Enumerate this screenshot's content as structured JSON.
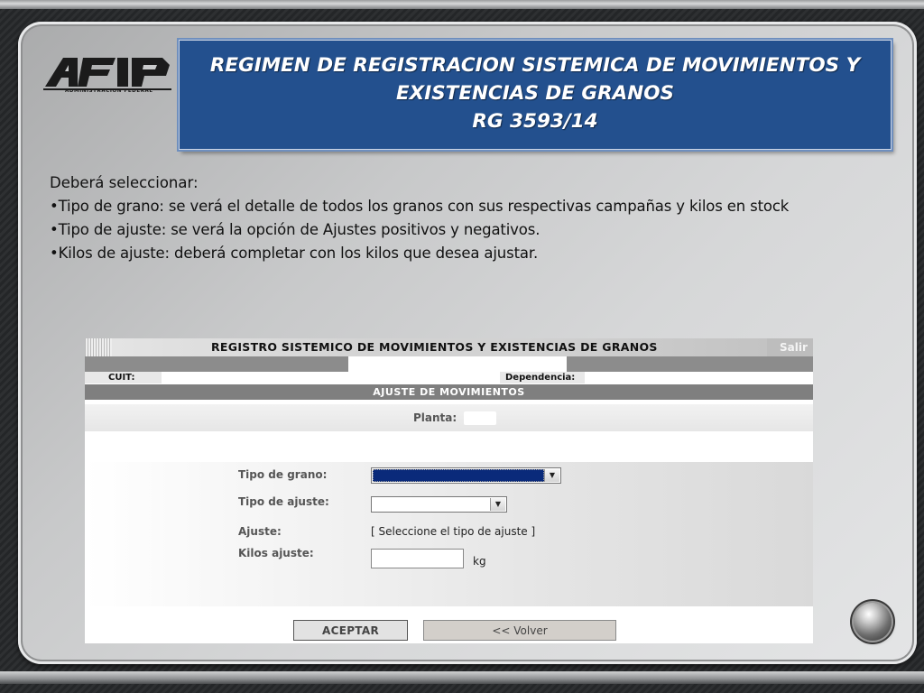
{
  "slide": {
    "logo_text": "AFIP",
    "logo_subtitle": "ADMINISTRACION FEDERAL",
    "title_lines": [
      "REGIMEN DE REGISTRACION SISTEMICA DE MOVIMIENTOS Y",
      "EXISTENCIAS DE GRANOS",
      "RG  3593/14"
    ],
    "intro": "Deberá seleccionar:",
    "bullets": [
      "Tipo de grano: se verá el detalle de  todos los granos con sus respectivas campañas y kilos en  stock",
      "Tipo de ajuste:  se verá la opción de Ajustes  positivos y negativos.",
      "Kilos de ajuste: deberá completar con los kilos que desea  ajustar."
    ]
  },
  "form": {
    "header_title": "REGISTRO SISTEMICO DE MOVIMIENTOS Y EXISTENCIAS DE GRANOS",
    "salir_label": "Salir",
    "cuit_label": "CUIT:",
    "dependencia_label": "Dependencia:",
    "section_title": "AJUSTE DE MOVIMIENTOS",
    "planta_label": "Planta:",
    "tipo_grano_label": "Tipo de grano:",
    "tipo_ajuste_label": "Tipo de ajuste:",
    "ajuste_label": "Ajuste:",
    "ajuste_value": "[ Seleccione el tipo de ajuste ]",
    "kilos_label": "Kilos ajuste:",
    "kilos_value": "",
    "kilos_unit": "kg",
    "aceptar_label": "ACEPTAR",
    "volver_label": "<< Volver"
  },
  "colors": {
    "title_box": "#23508e",
    "section_bar": "#7f7f7f",
    "select_highlight": "#0a2a7a"
  }
}
